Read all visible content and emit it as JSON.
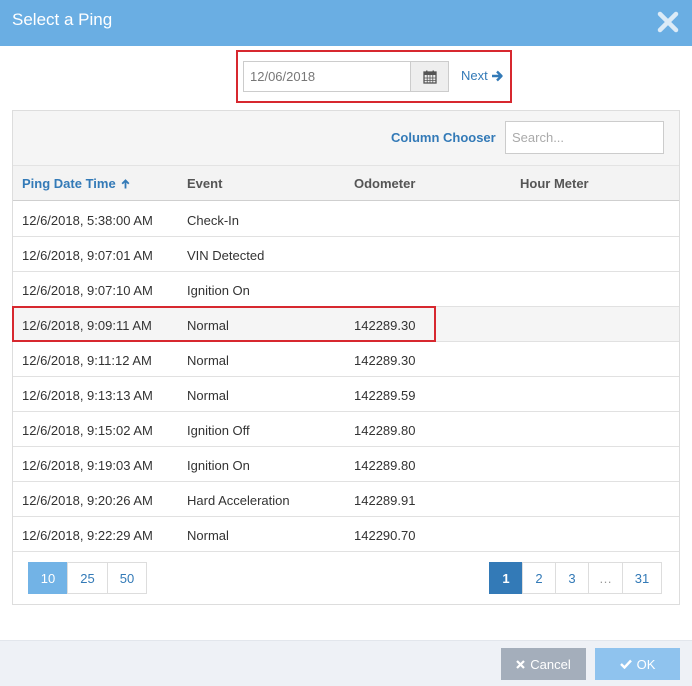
{
  "dialog": {
    "title": "Select a Ping",
    "close_icon": "close-icon"
  },
  "date_nav": {
    "date_value": "12/06/2018",
    "calendar_icon": "calendar-icon",
    "next_label": "Next",
    "next_icon": "arrow-right-icon"
  },
  "grid": {
    "column_chooser_label": "Column Chooser",
    "search_placeholder": "Search...",
    "columns": [
      "Ping Date Time",
      "Event",
      "Odometer",
      "Hour Meter"
    ],
    "sorted_column": "Ping Date Time",
    "sort_icon": "arrow-up-icon",
    "selected_row": 3,
    "rows": [
      [
        "12/6/2018, 5:38:00 AM",
        "Check-In",
        "",
        ""
      ],
      [
        "12/6/2018, 9:07:01 AM",
        "VIN Detected",
        "",
        ""
      ],
      [
        "12/6/2018, 9:07:10 AM",
        "Ignition On",
        "",
        ""
      ],
      [
        "12/6/2018, 9:09:11 AM",
        "Normal",
        "142289.30",
        ""
      ],
      [
        "12/6/2018, 9:11:12 AM",
        "Normal",
        "142289.30",
        ""
      ],
      [
        "12/6/2018, 9:13:13 AM",
        "Normal",
        "142289.59",
        ""
      ],
      [
        "12/6/2018, 9:15:02 AM",
        "Ignition Off",
        "142289.80",
        ""
      ],
      [
        "12/6/2018, 9:19:03 AM",
        "Ignition On",
        "142289.80",
        ""
      ],
      [
        "12/6/2018, 9:20:26 AM",
        "Hard Acceleration",
        "142289.91",
        ""
      ],
      [
        "12/6/2018, 9:22:29 AM",
        "Normal",
        "142290.70",
        ""
      ]
    ]
  },
  "pager": {
    "page_sizes": [
      "10",
      "25",
      "50"
    ],
    "active_size": "10",
    "pages": [
      "1",
      "2",
      "3",
      "…",
      "31"
    ],
    "active_page": "1"
  },
  "footer": {
    "cancel_label": "Cancel",
    "ok_label": "OK",
    "cancel_icon": "x-icon",
    "ok_icon": "check-icon"
  },
  "colors": {
    "title_bar": "#6aaee3",
    "link": "#337ab7",
    "highlight_border": "#d7282f",
    "cancel": "#a4aebb",
    "ok": "#8fc3ee"
  }
}
